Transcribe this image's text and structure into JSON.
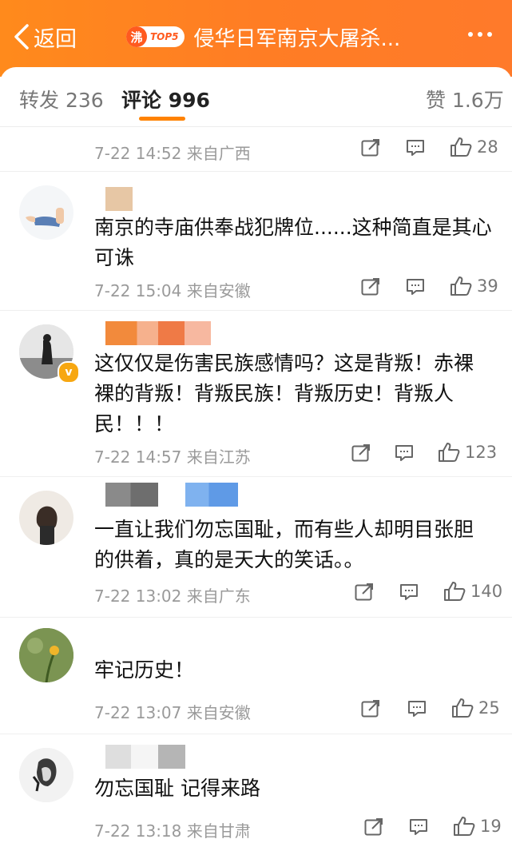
{
  "header": {
    "back_label": "返回",
    "hot_glyph": "沸",
    "hot_rank": "TOP5",
    "topic_title": "侵华日军南京大屠杀..."
  },
  "tabs": {
    "repost": "转发 236",
    "comments": "评论 996",
    "likes": "赞 1.6万"
  },
  "comments": [
    {
      "text": "",
      "time": "7-22 14:52",
      "source": "来自广西",
      "likes": "28"
    },
    {
      "text": "南京的寺庙供奉战犯牌位......这种简直是其心可诛",
      "time": "7-22 15:04",
      "source": "来自安徽",
      "likes": "39"
    },
    {
      "text": "这仅仅是伤害民族感情吗？这是背叛！赤裸裸的背叛！背叛民族！背叛历史！背叛人民！！！",
      "time": "7-22 14:57",
      "source": "来自江苏",
      "likes": "123"
    },
    {
      "text": "一直让我们勿忘国耻，而有些人却明目张胆的供着，真的是天大的笑话。。",
      "time": "7-22 13:02",
      "source": "来自广东",
      "likes": "140"
    },
    {
      "text": "牢记历史！",
      "time": "7-22 13:07",
      "source": "来自安徽",
      "likes": "25"
    },
    {
      "text": "勿忘国耻 记得来路",
      "time": "7-22 13:18",
      "source": "来自甘肃",
      "likes": "19"
    }
  ],
  "colors": {
    "header": "#ff8a1c",
    "accent": "#ff8200",
    "verified": "#f7a711"
  }
}
